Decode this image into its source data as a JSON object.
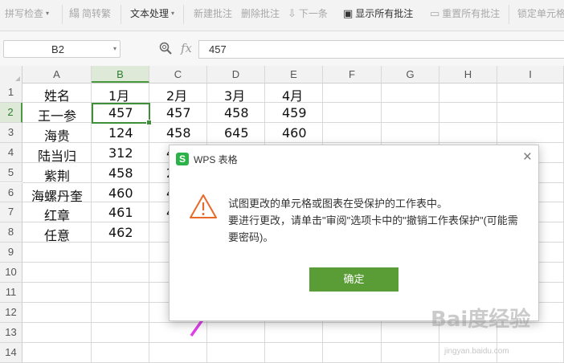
{
  "toolbar": {
    "items": [
      "拼写检查",
      "简转繁",
      "文本处理",
      "新建批注",
      "删除批注",
      "下一条",
      "显示所有批注",
      "重置所有批注",
      "锁定单元格"
    ]
  },
  "formula_bar": {
    "name_box": "B2",
    "fx": "fx",
    "formula": "457"
  },
  "grid": {
    "columns": [
      "A",
      "B",
      "C",
      "D",
      "E",
      "F",
      "G",
      "H",
      "I"
    ],
    "rows": [
      "1",
      "2",
      "3",
      "4",
      "5",
      "6",
      "7",
      "8",
      "9",
      "10",
      "11",
      "12",
      "13",
      "14"
    ],
    "cells": {
      "A": [
        "姓名",
        "王一参",
        "海贵",
        "陆当归",
        "紫荆",
        "海螺丹奎",
        "红章",
        "任意"
      ],
      "B": [
        "1月",
        "457",
        "124",
        "312",
        "458",
        "460",
        "461",
        "462"
      ],
      "C": [
        "2月",
        "457",
        "458",
        "4",
        "2",
        "4",
        "4",
        ""
      ],
      "D": [
        "3月",
        "458",
        "645",
        "",
        "",
        "",
        "",
        ""
      ],
      "E": [
        "4月",
        "459",
        "460",
        "",
        "",
        "",
        "",
        ""
      ]
    }
  },
  "dialog": {
    "app_icon": "S",
    "title": "WPS 表格",
    "message_line1": "试图更改的单元格或图表在受保护的工作表中。",
    "message_line2": "要进行更改，请单击\"审阅\"选项卡中的\"撤销工作表保护\"(可能需要密码)。",
    "ok_label": "确定",
    "close": "×"
  },
  "watermark": {
    "text": "Bai度经验",
    "sub": "jingyan.baidu.com"
  },
  "colors": {
    "accent_green": "#5a9c36",
    "selection_green": "#3f8f3a",
    "arrow_magenta": "#e040e8",
    "warning_orange": "#e8692a"
  }
}
